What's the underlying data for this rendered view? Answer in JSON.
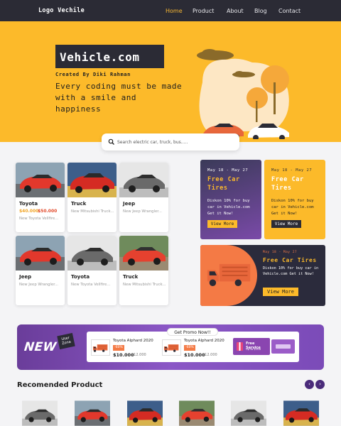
{
  "nav": {
    "logo": "Logo Vechile",
    "links": [
      "Home",
      "Product",
      "About",
      "Blog",
      "Contact"
    ]
  },
  "hero": {
    "title": "Vehicle.com",
    "subtitle": "Created By Diki Rahman",
    "description": "Every coding must be made with a smile and happiness"
  },
  "search": {
    "placeholder": "Search electric car, truck, bus....."
  },
  "products": [
    {
      "name": "Toyota",
      "price": "$40.000",
      "old_price": "$50.000",
      "desc": "New Toyota Vellfire..."
    },
    {
      "name": "Truck",
      "desc": "New Mitsubishi Truck..."
    },
    {
      "name": "Jeep",
      "desc": "New Jeep Wrangler..."
    },
    {
      "name": "Jeep",
      "desc": "New Jeep Wrangler..."
    },
    {
      "name": "Toyota",
      "desc": "New Toyota Vellfire..."
    },
    {
      "name": "Truck",
      "desc": "New Mitsubishi Truck..."
    }
  ],
  "promos": [
    {
      "date": "May 18 - May 27",
      "title": "Free Car Tires",
      "text": "Diskon 10% for buy car in Vehicle.com Get it Now!",
      "button": "View More"
    },
    {
      "date": "May 18 - May 27",
      "title": "Free Car Tires",
      "text": "Diskon 10% for buy car in Vehicle.com Get it Now!",
      "button": "View More"
    },
    {
      "date": "May 18 - May 27",
      "title": "Free Car Tires",
      "text": "Diskon 10% for buy car in Vehicle.com Get it Now!",
      "button": "View More"
    }
  ],
  "banner": {
    "new_label": "NEW",
    "zona_label": "User Zona",
    "promo_tag": "Get Promo Now!!",
    "items": [
      {
        "name": "Toyota Alphard 2020",
        "discount": "-60%",
        "price": "$10.000",
        "old_price": "$12.000"
      },
      {
        "name": "Toyota Alphard 2020",
        "discount": "-60%",
        "price": "$10.000",
        "old_price": "$12.000"
      }
    ],
    "free_service": "Free Service",
    "free_service_sub": "Up to $100"
  },
  "recommended": {
    "title": "Recomended Product",
    "prev": "‹",
    "next": "›"
  },
  "colors": {
    "accent": "#fcba2a",
    "dark": "#2b2b35",
    "purple": "#6a3d9a",
    "orange": "#f47a45"
  }
}
